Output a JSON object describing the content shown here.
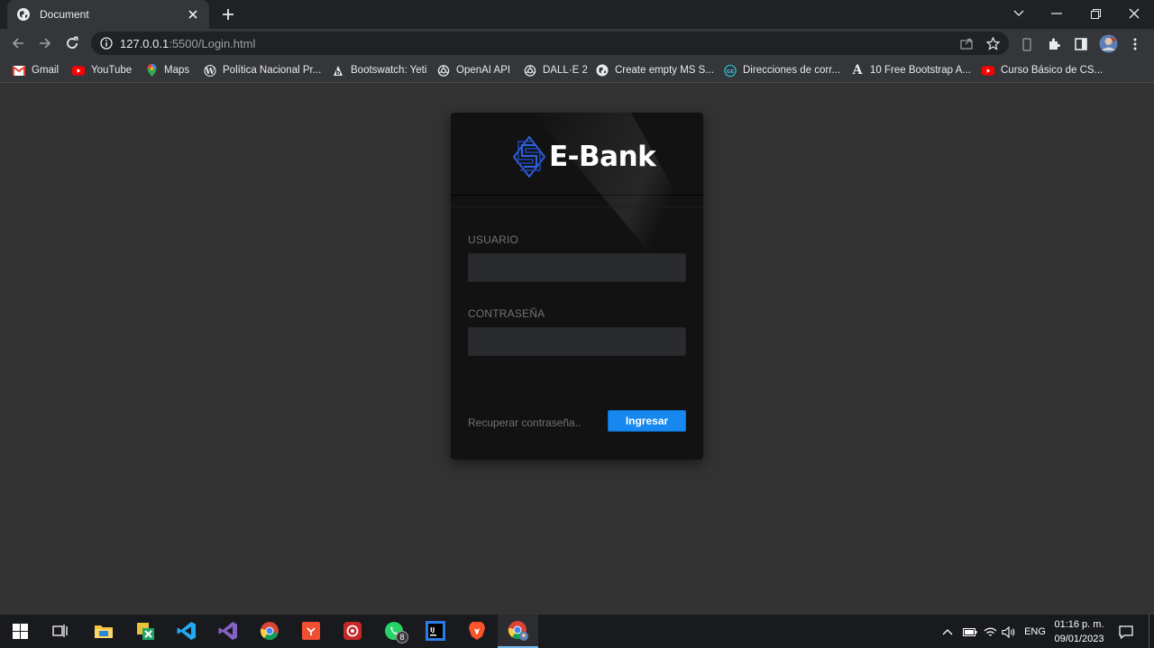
{
  "browser": {
    "tab": {
      "title": "Document"
    },
    "address": {
      "host": "127.0.0.1",
      "path": ":5500/Login.html"
    },
    "bookmarks": [
      {
        "label": "Gmail",
        "icon": "gmail-icon"
      },
      {
        "label": "YouTube",
        "icon": "youtube-icon"
      },
      {
        "label": "Maps",
        "icon": "maps-icon"
      },
      {
        "label": "Política Nacional Pr...",
        "icon": "wordpress-icon"
      },
      {
        "label": "Bootswatch: Yeti",
        "icon": "bootswatch-icon"
      },
      {
        "label": "OpenAI API",
        "icon": "openai-icon"
      },
      {
        "label": "DALL·E 2",
        "icon": "openai-icon"
      },
      {
        "label": "Create empty MS S...",
        "icon": "globe-icon"
      },
      {
        "label": "Direcciones de corr...",
        "icon": "site-icon"
      },
      {
        "label": "10 Free Bootstrap A...",
        "icon": "a-letter-icon"
      },
      {
        "label": "Curso Básico de CS...",
        "icon": "youtube-icon"
      }
    ]
  },
  "login": {
    "brand": "E-Bank",
    "user_label": "USUARIO",
    "password_label": "CONTRASEÑA",
    "forgot_link": "Recuperar contraseña..",
    "submit_label": "Ingresar",
    "colors": {
      "accent": "#1688ef",
      "card": "#121212",
      "page": "#333333"
    }
  },
  "taskbar": {
    "apps": [
      "windows-start",
      "task-view",
      "file-explorer",
      "excel",
      "vscode",
      "visual-studio",
      "chrome",
      "git",
      "screen-recorder",
      "whatsapp",
      "intellij",
      "brave",
      "chrome-profile"
    ],
    "whatsapp_badge": "8",
    "language": "ENG",
    "time": "01:16 p. m.",
    "date": "09/01/2023"
  }
}
